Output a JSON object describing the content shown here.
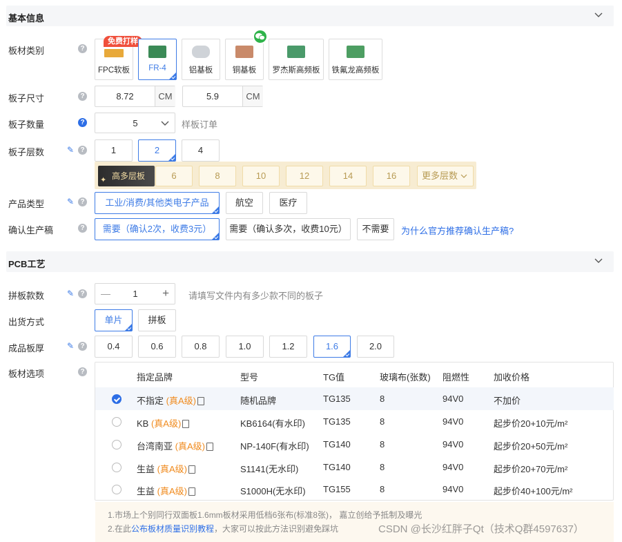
{
  "basic": {
    "title": "基本信息",
    "material": {
      "label": "板材类别",
      "free_badge": "免费打样",
      "items": [
        "FPC软板",
        "FR-4",
        "铝基板",
        "铜基板",
        "罗杰斯高频板",
        "铁氟龙高频板"
      ],
      "selected": "FR-4"
    },
    "size": {
      "label": "板子尺寸",
      "width": "8.72",
      "height": "5.9",
      "unit": "CM"
    },
    "quantity": {
      "label": "板子数量",
      "value": "5",
      "note": "样板订单"
    },
    "layers": {
      "label": "板子层数",
      "options": [
        "1",
        "2",
        "4"
      ],
      "selected": "2",
      "more_label": "高多层板",
      "high_options": [
        "6",
        "8",
        "10",
        "12",
        "14",
        "16"
      ],
      "more_layers": "更多层数"
    },
    "product_type": {
      "label": "产品类型",
      "options": [
        "工业/消费/其他类电子产品",
        "航空",
        "医疗"
      ],
      "selected": "工业/消费/其他类电子产品"
    },
    "confirm": {
      "label": "确认生产稿",
      "options": [
        "需要（确认2次，收费3元）",
        "需要（确认多次，收费10元）",
        "不需要"
      ],
      "selected": "需要（确认2次，收费3元）",
      "link": "为什么官方推荐确认生产稿?"
    }
  },
  "pcb": {
    "title": "PCB工艺",
    "panel_count": {
      "label": "拼板款数",
      "value": "1",
      "minus": "—",
      "plus": "+",
      "hint": "请填写文件内有多少款不同的板子"
    },
    "ship": {
      "label": "出货方式",
      "options": [
        "单片",
        "拼板"
      ],
      "selected": "单片"
    },
    "thickness": {
      "label": "成品板厚",
      "options": [
        "0.4",
        "0.6",
        "0.8",
        "1.0",
        "1.2",
        "1.6",
        "2.0"
      ],
      "selected": "1.6"
    },
    "board": {
      "label": "板材选项",
      "headers": [
        "指定品牌",
        "型号",
        "TG值",
        "玻璃布(张数)",
        "阻燃性",
        "加收价格"
      ],
      "rows": [
        {
          "brand": "不指定",
          "grade": "(真A级)",
          "model": "随机品牌",
          "tg": "TG135",
          "glass": "8",
          "flame": "94V0",
          "price": "不加价",
          "checked": true
        },
        {
          "brand": "KB",
          "grade": "(真A级)",
          "model": "KB6164(有水印)",
          "tg": "TG135",
          "glass": "8",
          "flame": "94V0",
          "price": "起步价20+10元/m²",
          "checked": false
        },
        {
          "brand": "台湾南亚",
          "grade": "(真A级)",
          "model": "NP-140F(有水印)",
          "tg": "TG140",
          "glass": "8",
          "flame": "94V0",
          "price": "起步价20+50元/m²",
          "checked": false
        },
        {
          "brand": "生益",
          "grade": "(真A级)",
          "model": "S1141(无水印)",
          "tg": "TG140",
          "glass": "8",
          "flame": "94V0",
          "price": "起步价20+70元/m²",
          "checked": false
        },
        {
          "brand": "生益",
          "grade": "(真A级)",
          "model": "S1000H(无水印)",
          "tg": "TG155",
          "glass": "8",
          "flame": "94V0",
          "price": "起步价40+100元/m²",
          "checked": false
        }
      ],
      "note1": "1.市场上个别同行双面板1.6mm板材采用低档6张布(标准8张)，  嘉立创给予抵制及曝光",
      "note2_pre": "2.在此",
      "note2_link": "公布板材质量识别教程",
      "note2_post": "，大家可以按此方法识别避免踩坑"
    }
  },
  "watermark": "CSDN @长沙红胖子Qt（技术Q群4597637）"
}
